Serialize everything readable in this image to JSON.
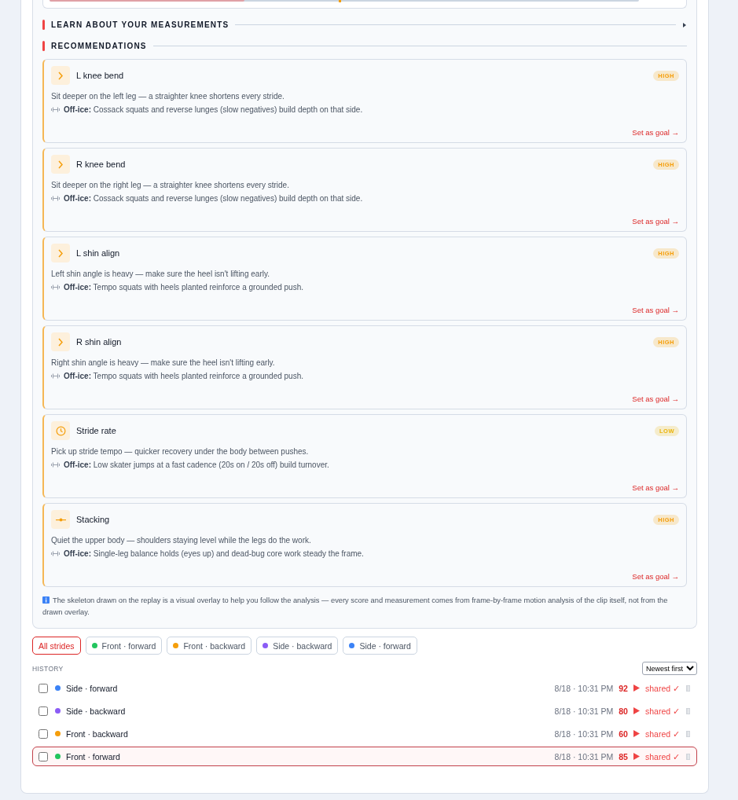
{
  "measurement": {
    "level": 0.33
  },
  "learn_section": {
    "title": "LEARN ABOUT YOUR MEASUREMENTS",
    "expanded": false
  },
  "recommendations": {
    "title": "RECOMMENDATIONS",
    "items": [
      {
        "kind": "chevron",
        "title": "L knee bend",
        "priority": "HIGH",
        "color": "#f59e0b",
        "description": "Sit deeper on the left leg — a straighter knee shortens every stride.",
        "office_label": "Off-ice:",
        "office": "Cossack squats and reverse lunges (slow negatives) build depth on that side.",
        "action": "Set as goal →"
      },
      {
        "kind": "chevron",
        "title": "R knee bend",
        "priority": "HIGH",
        "color": "#f59e0b",
        "description": "Sit deeper on the right leg — a straighter knee shortens every stride.",
        "office_label": "Off-ice:",
        "office": "Cossack squats and reverse lunges (slow negatives) build depth on that side.",
        "action": "Set as goal →"
      },
      {
        "kind": "chevron",
        "title": "L shin align",
        "priority": "HIGH",
        "color": "#f59e0b",
        "description": "Left shin angle is heavy — make sure the heel isn't lifting early.",
        "office_label": "Off-ice:",
        "office": "Tempo squats with heels planted reinforce a grounded push.",
        "action": "Set as goal →"
      },
      {
        "kind": "chevron",
        "title": "R shin align",
        "priority": "HIGH",
        "color": "#f59e0b",
        "description": "Right shin angle is heavy — make sure the heel isn't lifting early.",
        "office_label": "Off-ice:",
        "office": "Tempo squats with heels planted reinforce a grounded push.",
        "action": "Set as goal →"
      },
      {
        "kind": "clock",
        "title": "Stride rate",
        "priority": "LOW",
        "color": "#eab308",
        "description": "Pick up stride tempo — quicker recovery under the body between pushes.",
        "office_label": "Off-ice:",
        "office": "Low skater jumps at a fast cadence (20s on / 20s off) build turnover.",
        "action": "Set as goal →"
      },
      {
        "kind": "level",
        "title": "Stacking",
        "priority": "HIGH",
        "color": "#f59e0b",
        "description": "Quiet the upper body — shoulders staying level while the legs do the work.",
        "office_label": "Off-ice:",
        "office": "Single-leg balance holds (eyes up) and dead-bug core work steady the frame.",
        "action": "Set as goal →"
      }
    ]
  },
  "note": "The skeleton drawn on the replay is a visual overlay to help you follow the analysis — every score and measurement comes from frame-by-frame motion analysis of the clip itself, not from the drawn overlay.",
  "filters": [
    {
      "label": "All strides",
      "selected": true
    },
    {
      "label": "Front · forward",
      "selected": false,
      "color": "#22c55e"
    },
    {
      "label": "Front · backward",
      "selected": false,
      "color": "#f59e0b"
    },
    {
      "label": "Side · backward",
      "selected": false,
      "color": "#8b5cf6"
    },
    {
      "label": "Side · forward",
      "selected": false,
      "color": "#3b82f6"
    }
  ],
  "history": {
    "title": "HISTORY",
    "sort": "Newest first",
    "rows": [
      {
        "label": "Side · forward",
        "color": "#3b82f6",
        "time": "8/18 · 10:31 PM",
        "score": "92",
        "status": "shared ✓",
        "checked": false,
        "selected": false
      },
      {
        "label": "Side · backward",
        "color": "#8b5cf6",
        "time": "8/18 · 10:31 PM",
        "score": "80",
        "status": "shared ✓",
        "checked": false,
        "selected": false
      },
      {
        "label": "Front · backward",
        "color": "#f59e0b",
        "time": "8/18 · 10:31 PM",
        "score": "60",
        "status": "shared ✓",
        "checked": false,
        "selected": false
      },
      {
        "label": "Front · forward",
        "color": "#22c55e",
        "time": "8/18 · 10:31 PM",
        "score": "85",
        "status": "shared ✓",
        "checked": false,
        "selected": true
      }
    ]
  }
}
